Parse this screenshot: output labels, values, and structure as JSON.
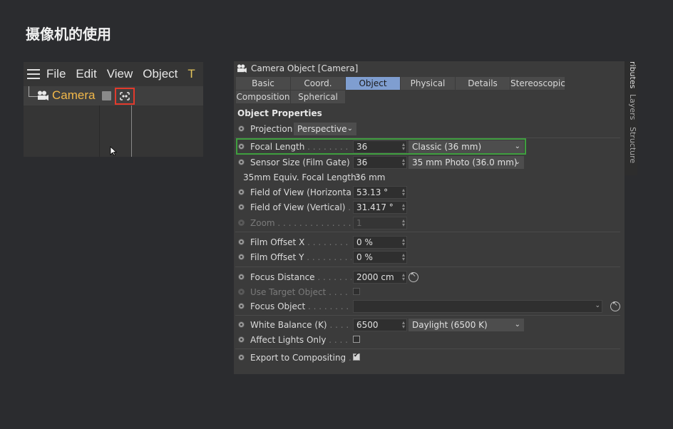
{
  "page": {
    "title": "摄像机的使用"
  },
  "object_manager": {
    "menu": [
      "File",
      "Edit",
      "View",
      "Object",
      "T"
    ],
    "object_name": "Camera"
  },
  "attribute_manager": {
    "header": "Camera Object [Camera]",
    "tabs_row1": [
      "Basic",
      "Coord.",
      "Object",
      "Physical",
      "Details",
      "Stereoscopic"
    ],
    "tabs_row2": [
      "Composition",
      "Spherical"
    ],
    "active_tab": "Object",
    "section_title": "Object Properties",
    "projection": {
      "label": "Projection",
      "value": "Perspective"
    },
    "focal_length": {
      "label": "Focal Length",
      "dots": " . . . . . . . . . . .",
      "value": "36",
      "preset": "Classic (36 mm)"
    },
    "sensor_size": {
      "label": "Sensor Size (Film Gate)",
      "dots": " .",
      "value": "36",
      "preset": "35 mm Photo (36.0 mm)"
    },
    "equiv": {
      "label": "35mm Equiv. Focal Length:",
      "value": "36 mm"
    },
    "fov_h": {
      "label": "Field of View (Horizontal)",
      "value": "53.13 °"
    },
    "fov_v": {
      "label": "Field of View (Vertical)",
      "dots": " . . .",
      "value": "31.417 °"
    },
    "zoom": {
      "label": "Zoom",
      "dots": " . . . . . . . . . . . . . . . . . .",
      "value": "1"
    },
    "film_offset_x": {
      "label": "Film Offset X",
      "dots": " . . . . . . . . . . . .",
      "value": "0 %"
    },
    "film_offset_y": {
      "label": "Film Offset Y",
      "dots": " . . . . . . . . . . . .",
      "value": "0 %"
    },
    "focus_distance": {
      "label": "Focus Distance",
      "dots": " . . . . . . . . . .",
      "value": "2000 cm"
    },
    "use_target": {
      "label": "Use Target Object",
      "dots": " . . . . . .",
      "checked": false
    },
    "focus_object": {
      "label": "Focus Object",
      "dots": " . . . . . . . . . . . .",
      "value": ""
    },
    "white_balance": {
      "label": "White Balance (K)",
      "dots": " . . . . . .",
      "value": "6500",
      "preset": "Daylight (6500 K)"
    },
    "affect_lights": {
      "label": "Affect Lights Only",
      "dots": " . . . . . . .",
      "checked": false
    },
    "export": {
      "label": "Export to Compositing",
      "dots": " . .",
      "checked": true
    },
    "side_tabs": [
      "ributes",
      "Layers",
      "Structure"
    ]
  },
  "colors": {
    "accent_tab": "#7f9ed0",
    "object_name": "#f2b84a",
    "highlight_red": "#e23a2c",
    "highlight_green": "#3f9f3f"
  }
}
